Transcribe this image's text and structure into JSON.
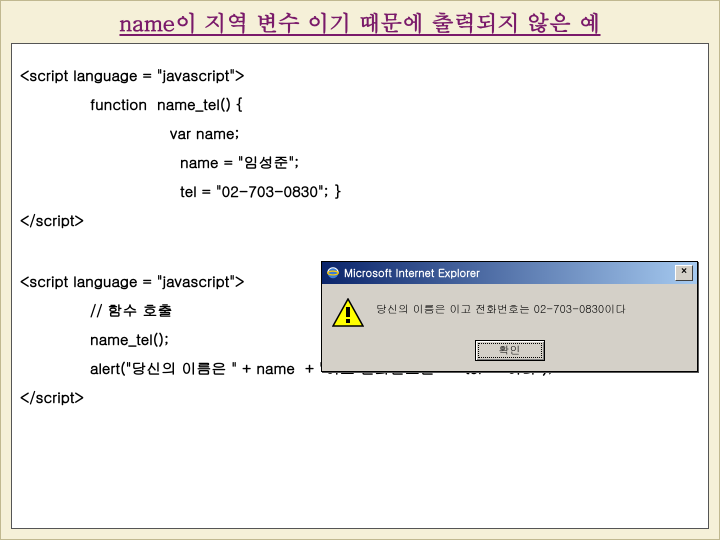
{
  "title": "name이 지역 변수 이기 때문에 출력되지 않은 예",
  "code": {
    "l1": "<script language = \"javascript\">",
    "l2": "function  name_tel() {",
    "l3": "var name;",
    "l4": "name = \"임성준\";",
    "l5": "tel = \"02-703-0830\"; }",
    "l6": "</script>",
    "l7": "<script language = \"javascript\">",
    "l8": "// 함수 호출",
    "l9": "name_tel();",
    "l10": "alert(\"당신의 이름은 \" + name  + \"이고 전화번호는 \" + tel + \"이다\");",
    "l11": "</script>"
  },
  "dialog": {
    "title": "Microsoft Internet Explorer",
    "message": "당신의 이름은  이고 전화번호는 02-703-0830이다",
    "ok": "확인"
  }
}
